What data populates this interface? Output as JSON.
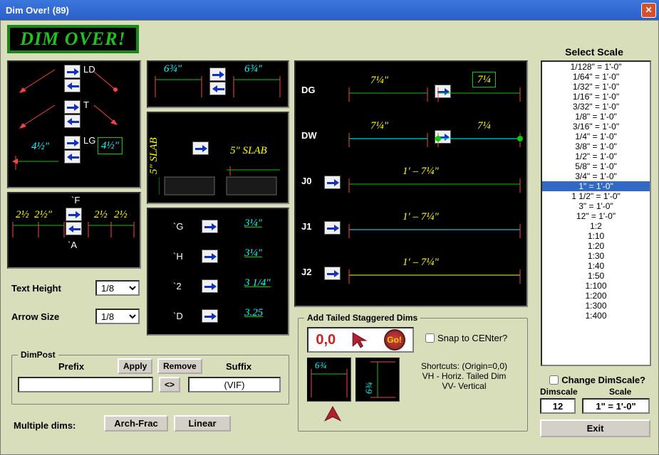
{
  "window": {
    "title": "Dim Over! (89)"
  },
  "logo": "DIM OVER!",
  "panel1": {
    "labels": [
      "LD",
      "T",
      "LG"
    ],
    "dim_left": "4½\"",
    "dim_right": "4½\""
  },
  "panel2": {
    "labels": [
      "`F",
      "`A"
    ],
    "dims": [
      "2½",
      "2½\"",
      "2½",
      "2½"
    ]
  },
  "panel3": {
    "dim_l": "6¾\"",
    "dim_r": "6¾\""
  },
  "panel4": {
    "slab_v": "5\" SLAB",
    "slab_h": "5\" SLAB"
  },
  "panel5": {
    "rows": [
      {
        "label": "`G",
        "dim": "3¼\""
      },
      {
        "label": "`H",
        "dim": "3¼\""
      },
      {
        "label": "`2",
        "dim": "3 1/4\""
      },
      {
        "label": "`D",
        "dim": "3.25"
      }
    ]
  },
  "panel6": {
    "rows": [
      {
        "label": "DG",
        "dim_l": "7¼\"",
        "dim_r": "7¼"
      },
      {
        "label": "DW",
        "dim_l": "7¼\"",
        "dim_r": "7¼"
      },
      {
        "label": "J0",
        "dim": "1' – 7¼\""
      },
      {
        "label": "J1",
        "dim": "1' – 7¼\""
      },
      {
        "label": "J2",
        "dim": "1' – 7¼\""
      }
    ]
  },
  "controls": {
    "text_height": {
      "label": "Text Height",
      "value": "1/8"
    },
    "arrow_size": {
      "label": "Arrow Size",
      "value": "1/8"
    }
  },
  "dimpost": {
    "title": "DimPost",
    "prefix_label": "Prefix",
    "suffix_label": "Suffix",
    "apply": "Apply",
    "remove": "Remove",
    "swap": "<>",
    "suffix_value": "(VIF)",
    "prefix_value": ""
  },
  "multiple": {
    "label": "Multiple dims:",
    "arch": "Arch-Frac",
    "linear": "Linear"
  },
  "tailed": {
    "title": "Add Tailed Staggered Dims",
    "origin": "0,0",
    "go": "Go!",
    "snap": "Snap to CENter?",
    "shortcuts_title": "Shortcuts: (Origin=0,0)",
    "shortcuts_l1": "VH - Horiz. Tailed Dim",
    "shortcuts_l2": "VV- Vertical",
    "preview_h": "6¾",
    "preview_v": "6¾"
  },
  "scale": {
    "title": "Select Scale",
    "items": [
      "1/128\" = 1'-0\"",
      "1/64\" = 1'-0\"",
      "1/32\" = 1'-0\"",
      "1/16\" = 1'-0\"",
      "3/32\" = 1'-0\"",
      "1/8\" = 1'-0\"",
      "3/16\" = 1'-0\"",
      "1/4\" = 1'-0\"",
      "3/8\" = 1'-0\"",
      "1/2\" = 1'-0\"",
      "5/8\" = 1'-0\"",
      "3/4\" = 1'-0\"",
      "1\" = 1'-0\"",
      "1 1/2\" = 1'-0\"",
      "3\" = 1'-0\"",
      "12\" = 1'-0\"",
      "1:2",
      "1:10",
      "1:20",
      "1:30",
      "1:40",
      "1:50",
      "1:100",
      "1:200",
      "1:300",
      "1:400"
    ],
    "selected_index": 12
  },
  "dimscale": {
    "change_label": "Change DimScale?",
    "dimscale_label": "Dimscale",
    "scale_label": "Scale",
    "dimscale_value": "12",
    "scale_value": "1\" = 1'-0\""
  },
  "exit": "Exit"
}
